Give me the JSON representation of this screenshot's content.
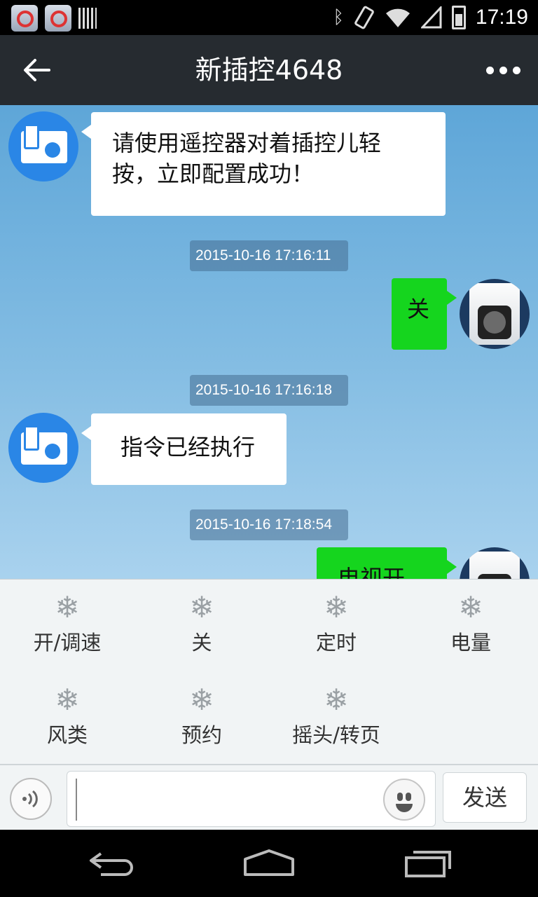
{
  "status_bar": {
    "time": "17:19",
    "left_icons": [
      "app-icon",
      "app-icon",
      "barcode-icon"
    ],
    "right_icons": [
      "bluetooth-icon",
      "vibrate-icon",
      "wifi-icon",
      "signal-icon",
      "battery-icon"
    ]
  },
  "header": {
    "title": "新插控4648",
    "back_icon": "arrow-left-icon",
    "more_icon": "more-dots-icon"
  },
  "messages": [
    {
      "from": "device",
      "text": "请使用遥控器对着插控儿轻按，立即配置成功！"
    },
    {
      "timestamp": "2015-10-16 17:16:11"
    },
    {
      "from": "user",
      "text": "关"
    },
    {
      "timestamp": "2015-10-16 17:16:18"
    },
    {
      "from": "device",
      "text": "指令已经执行"
    },
    {
      "timestamp": "2015-10-16 17:18:54"
    },
    {
      "from": "user",
      "text": "电视开关"
    }
  ],
  "commands": [
    {
      "label": "开/调速",
      "icon": "snowflake-icon"
    },
    {
      "label": "关",
      "icon": "snowflake-icon"
    },
    {
      "label": "定时",
      "icon": "snowflake-icon"
    },
    {
      "label": "电量",
      "icon": "snowflake-icon"
    },
    {
      "label": "风类",
      "icon": "snowflake-icon"
    },
    {
      "label": "预约",
      "icon": "snowflake-icon"
    },
    {
      "label": "摇头/转页",
      "icon": "snowflake-icon"
    }
  ],
  "input_bar": {
    "value": "",
    "send_label": "发送",
    "voice_icon": "voice-icon",
    "emoji_icon": "emoji-icon"
  },
  "nav_bar": {
    "icons": [
      "back-icon",
      "home-icon",
      "recents-icon"
    ]
  },
  "colors": {
    "titlebar": "#262b30",
    "outgoing_bubble": "#15d51e",
    "incoming_bubble": "#ffffff",
    "bot_avatar": "#2a86e6"
  }
}
